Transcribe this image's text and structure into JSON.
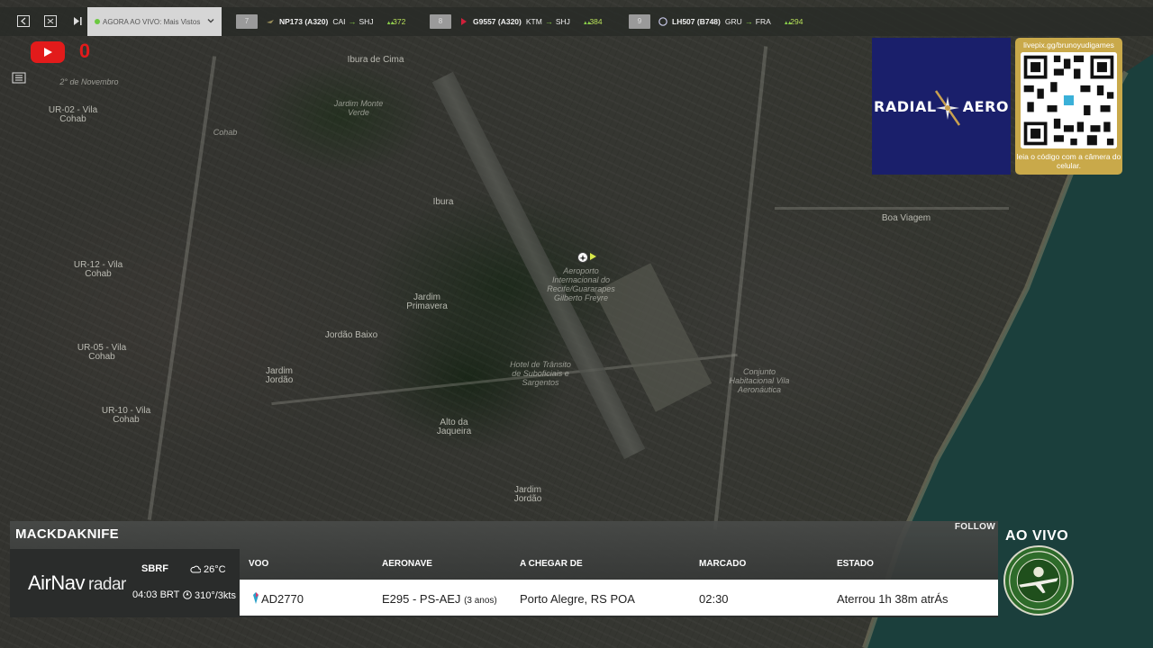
{
  "topbar": {
    "dropdown_label": "AGORA AO VIVO: Mais Vistos",
    "flights": [
      {
        "rank": "7",
        "callsign": "NP173 (A320)",
        "origin": "CAI",
        "destination": "SHJ",
        "count": "372"
      },
      {
        "rank": "8",
        "callsign": "G9557 (A320)",
        "origin": "KTM",
        "destination": "SHJ",
        "count": "384"
      },
      {
        "rank": "9",
        "callsign": "LH507 (B748)",
        "origin": "GRU",
        "destination": "FRA",
        "count": "294"
      }
    ]
  },
  "youtube": {
    "count": "0"
  },
  "map": {
    "labels": [
      "Ibura de Cima",
      "Jardim Monte Verde",
      "UR-02 - Vila Cohab",
      "Cohab",
      "Ibura",
      "UR-12 - Vila Cohab",
      "Jardim Primavera",
      "Jordão Baixo",
      "Jardim Jordão",
      "Alto da Jaqueira",
      "Aeroporto Internacional do Recife/Guararapes Gilberto Freyre",
      "Hotel de Trânsito de Suboficiais e Sargentos",
      "Conjunto Habitacional Vila Aeronáutica",
      "Boa Viagem",
      "UR-05 - Vila Cohab",
      "UR-10 - Vila Cohab",
      "Jardim Jordão",
      "2° de Novembro"
    ]
  },
  "radial_aero": {
    "left": "RADIAL",
    "right": "AERO"
  },
  "qr": {
    "url": "livepix.gg/brunoyudigames",
    "caption": "leia o código com a câmera do celular."
  },
  "panel": {
    "title": "MACKDAKNIFE",
    "follow": "FOLLOW",
    "brand": "AirNav",
    "brand_sub": "radar",
    "airport": "SBRF",
    "local_time": "04:03 BRT",
    "temperature": "26°C",
    "wind": "310°/3kts",
    "headers": {
      "flight": "VOO",
      "aircraft": "AERONAVE",
      "from": "A CHEGAR DE",
      "scheduled": "MARCADO",
      "status": "ESTADO"
    },
    "row": {
      "flight": "AD2770",
      "aircraft": "E295 - PS-AEJ",
      "aircraft_age": "(3 anos)",
      "from": "Porto Alegre, RS POA",
      "scheduled": "02:30",
      "status": "Aterrou 1h 38m atrÁs"
    }
  },
  "live": {
    "label": "AO VIVO"
  },
  "colors": {
    "accent": "#8ad04a",
    "youtube": "#e21b1b",
    "radial_bg": "#1a1f6b",
    "qr_bg": "#c9a94a"
  }
}
